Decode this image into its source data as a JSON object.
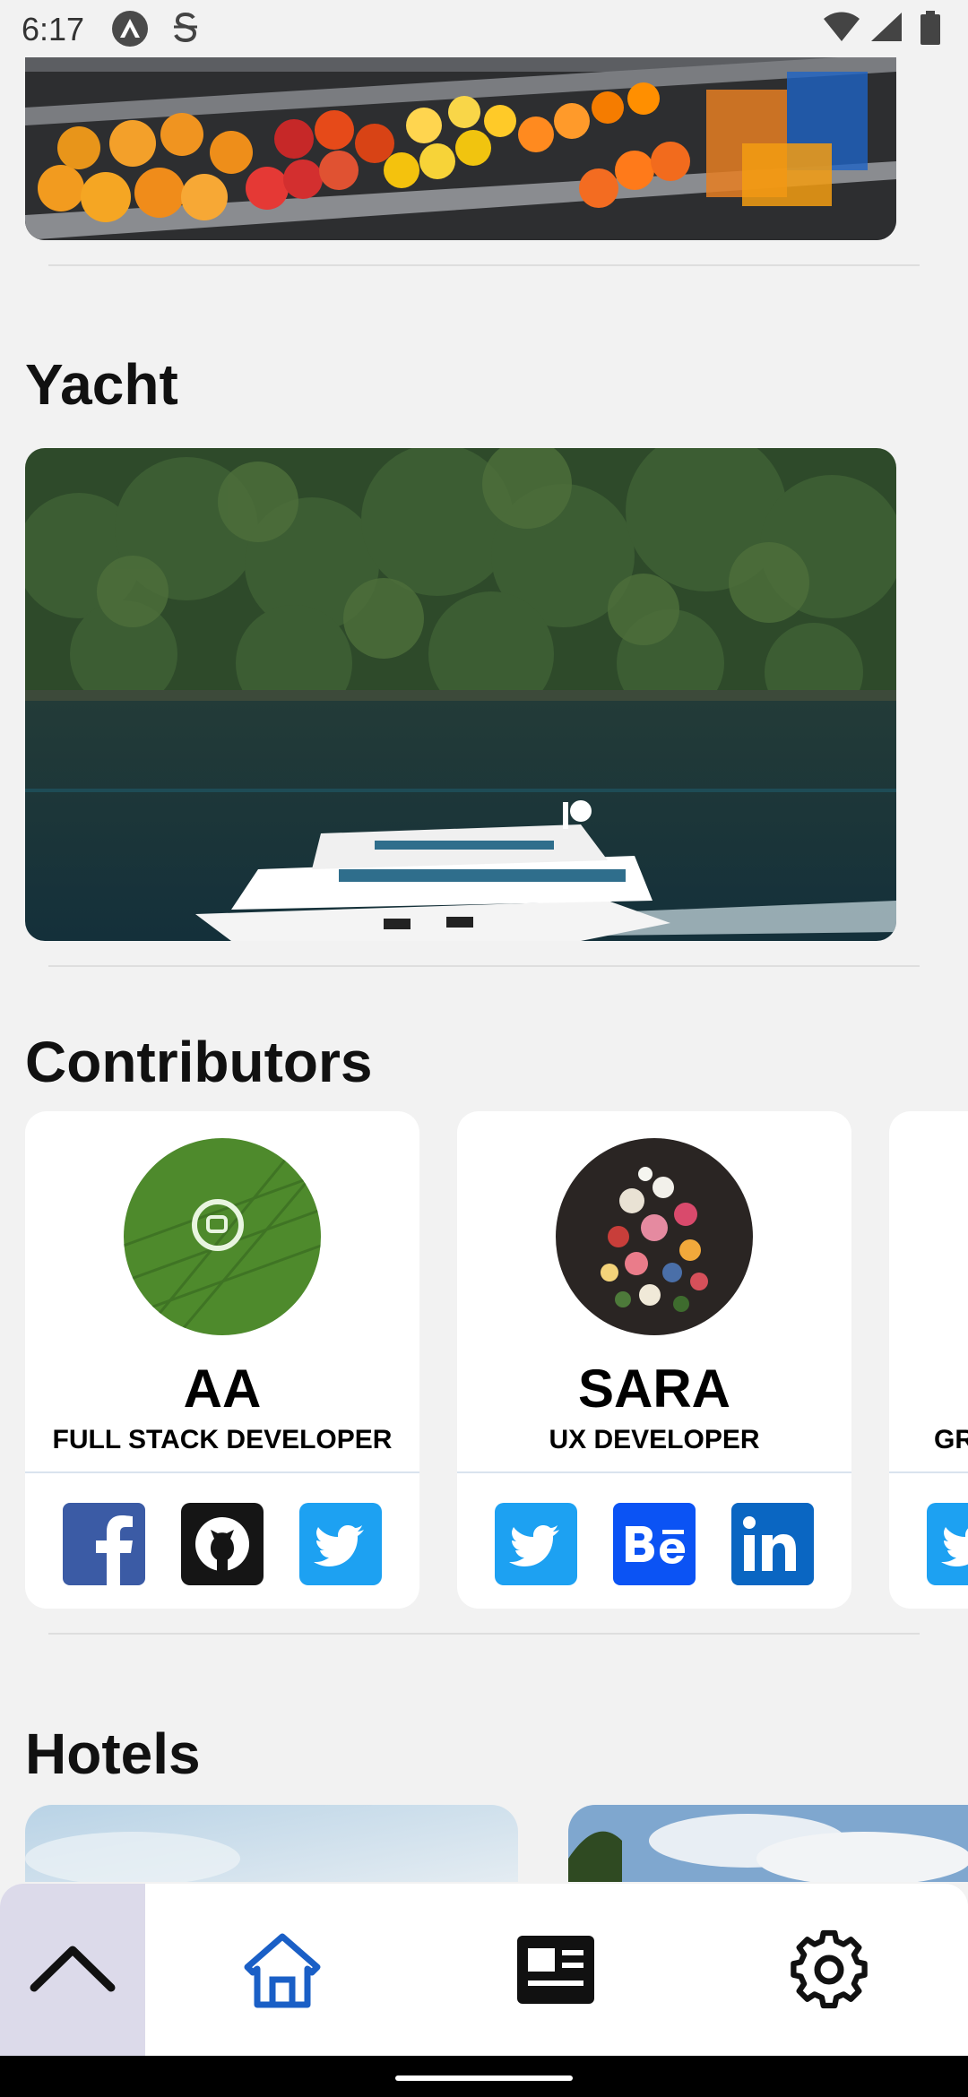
{
  "status_bar": {
    "time": "6:17",
    "icons": [
      "app-badge-icon",
      "s-badge-icon",
      "wifi-icon",
      "signal-icon",
      "battery-icon"
    ]
  },
  "sections": {
    "yacht": {
      "title": "Yacht"
    },
    "contributors": {
      "title": "Contributors",
      "cards": [
        {
          "name": "AA",
          "role": "FULL STACK DEVELOPER",
          "links": [
            "facebook-icon",
            "github-icon",
            "twitter-icon"
          ]
        },
        {
          "name": "SARA",
          "role": "UX DEVELOPER",
          "links": [
            "twitter-icon",
            "behance-icon",
            "linkedin-icon"
          ]
        },
        {
          "name": "",
          "role": "GR",
          "links": [
            "twitter-icon"
          ]
        }
      ]
    },
    "hotels": {
      "title": "Hotels"
    }
  },
  "bottom_nav": {
    "items": [
      "scroll-up-icon",
      "home-icon",
      "news-icon",
      "settings-icon"
    ],
    "active": "home-icon",
    "colors": {
      "active": "#1a5fc6",
      "inactive": "#111111",
      "up_bg": "#dcdaea"
    }
  }
}
